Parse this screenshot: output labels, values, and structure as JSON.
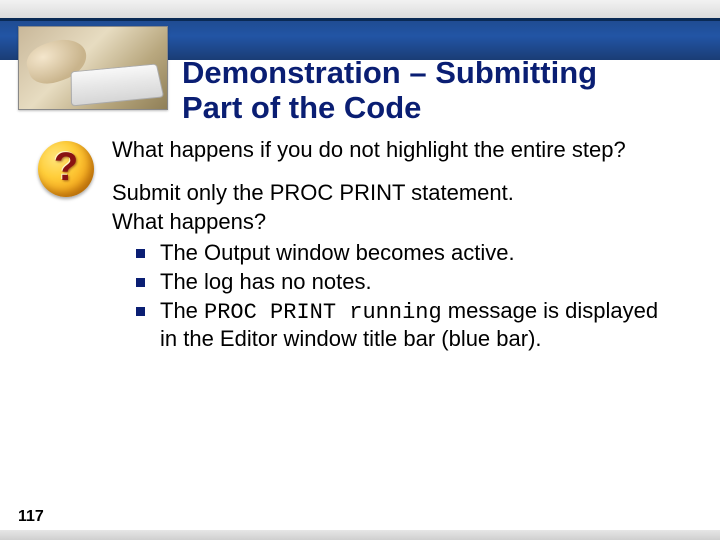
{
  "title_line1": "Demonstration – Submitting",
  "title_line2": "Part of the Code",
  "question_glyph": "?",
  "lead": "What happens if you do not highlight the entire step?",
  "para1": "Submit only the PROC PRINT statement.",
  "para2": "What happens?",
  "bullets": [
    {
      "pre": "The Output window becomes active."
    },
    {
      "pre": "The log has no notes."
    },
    {
      "pre": "The ",
      "code": "PROC PRINT running",
      "post": " message is displayed in the Editor window title bar (blue bar)."
    }
  ],
  "slide_number": "117"
}
